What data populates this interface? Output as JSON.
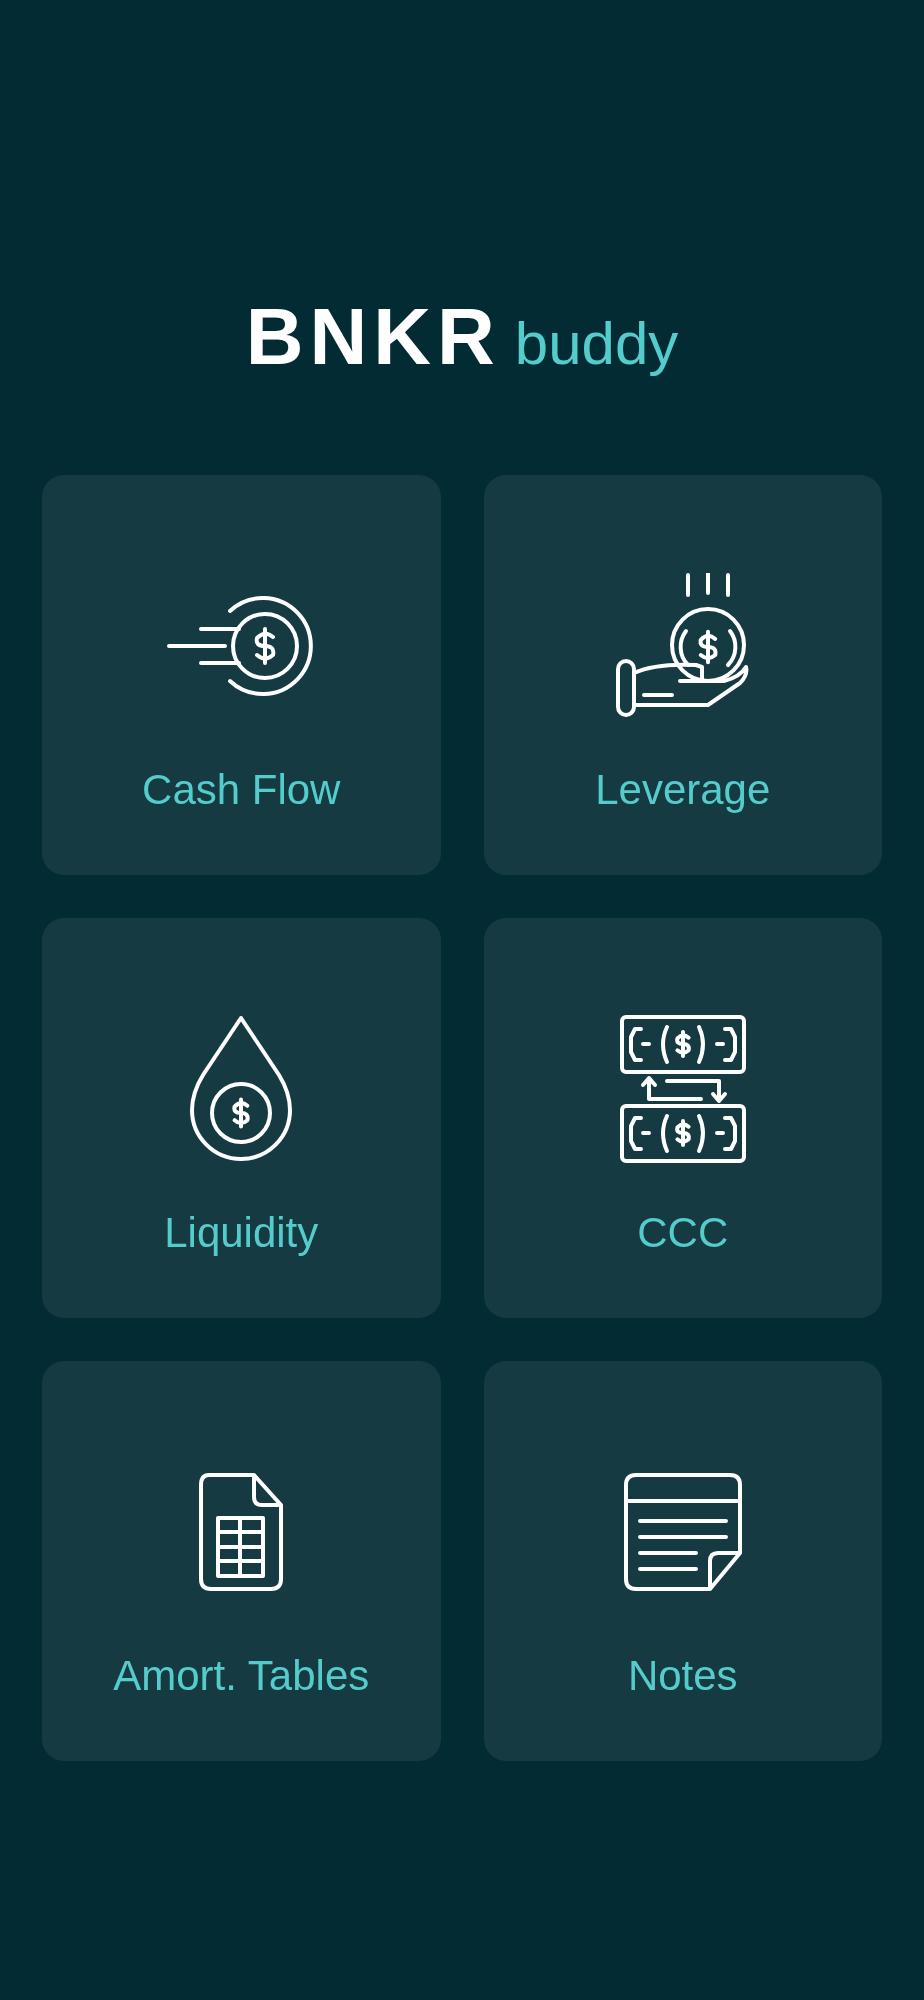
{
  "logo": {
    "primary": "BNKR",
    "secondary": "buddy"
  },
  "tiles": [
    {
      "label": "Cash Flow"
    },
    {
      "label": "Leverage"
    },
    {
      "label": "Liquidity"
    },
    {
      "label": "CCC"
    },
    {
      "label": "Amort. Tables"
    },
    {
      "label": "Notes"
    }
  ]
}
